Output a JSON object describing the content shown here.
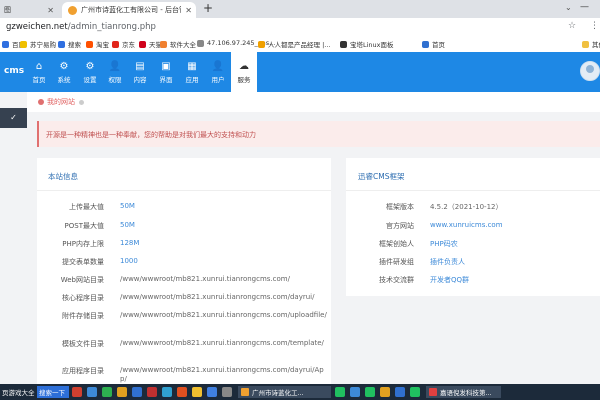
{
  "browser": {
    "tabs": [
      {
        "label": "图"
      },
      {
        "label": "广州市诗蓝化工有限公司 - 后台管理"
      }
    ],
    "new_tab": "+",
    "url_host": "gzweichen.net",
    "url_path": "/admin_tianrong.php"
  },
  "bookmarks": [
    {
      "label": "百度",
      "color": "#2f6fe0"
    },
    {
      "label": "苏宁易购",
      "color": "#f0c000"
    },
    {
      "label": "搜索",
      "color": "#2f6fe0"
    },
    {
      "label": "淘宝",
      "color": "#ff5000"
    },
    {
      "label": "京东",
      "color": "#e1251b"
    },
    {
      "label": "天猫",
      "color": "#d0021b"
    },
    {
      "label": "软件大全",
      "color": "#f08030"
    },
    {
      "label": "47.106.97.245_eas...",
      "color": "#888888"
    },
    {
      "label": "人人都是产品经理 |...",
      "color": "#f0a000"
    },
    {
      "label": "宝塔Linux面板",
      "color": "#333333"
    },
    {
      "label": "首页",
      "color": "#3070d0"
    },
    {
      "label": "其他书签",
      "color": "#f0c040"
    }
  ],
  "header": {
    "logo": "cms",
    "nav": [
      {
        "label": "首页",
        "icon": "⌂"
      },
      {
        "label": "系统",
        "icon": "⚙"
      },
      {
        "label": "设置",
        "icon": "⚙"
      },
      {
        "label": "权限",
        "icon": "👤"
      },
      {
        "label": "内容",
        "icon": "▤"
      },
      {
        "label": "界面",
        "icon": "▣"
      },
      {
        "label": "应用",
        "icon": "▦"
      },
      {
        "label": "用户",
        "icon": "👤"
      },
      {
        "label": "服务",
        "icon": "☁"
      }
    ]
  },
  "breadcrumb": "我的网站",
  "notice": "开源是一种精神也是一种奉献，您的帮助是对我们最大的支持和动力",
  "site_info": {
    "title": "本站信息",
    "rows": [
      {
        "label": "上传最大值",
        "value": "50M"
      },
      {
        "label": "POST最大值",
        "value": "50M"
      },
      {
        "label": "PHP内存上限",
        "value": "128M"
      },
      {
        "label": "提交表单数量",
        "value": "1000"
      },
      {
        "label": "Web网站目录",
        "value": "/www/wwwroot/mb821.xunrui.tianrongcms.com/"
      },
      {
        "label": "核心程序目录",
        "value": "/www/wwwroot/mb821.xunrui.tianrongcms.com/dayrui/"
      },
      {
        "label": "附件存储目录",
        "value": "/www/wwwroot/mb821.xunrui.tianrongcms.com/uploadfile/"
      },
      {
        "label": "模板文件目录",
        "value": "/www/wwwroot/mb821.xunrui.tianrongcms.com/template/"
      },
      {
        "label": "应用程序目录",
        "value": "/www/wwwroot/mb821.xunrui.tianrongcms.com/dayrui/App/"
      }
    ]
  },
  "framework": {
    "title": "迅睿CMS框架",
    "rows": [
      {
        "label": "框架版本",
        "value": "4.5.2（2021-10-12）"
      },
      {
        "label": "官方网站",
        "value": "www.xunruicms.com"
      },
      {
        "label": "框架创始人",
        "value": "PHP码农"
      },
      {
        "label": "插件研发组",
        "value": "插件负责人"
      },
      {
        "label": "技术交流群",
        "value": "开发者QQ群"
      }
    ]
  },
  "taskbar": {
    "items": [
      "页游戏大全",
      "搜索一下",
      "广州市诗蓝化工...",
      "嘉语倪发科技第..."
    ]
  }
}
